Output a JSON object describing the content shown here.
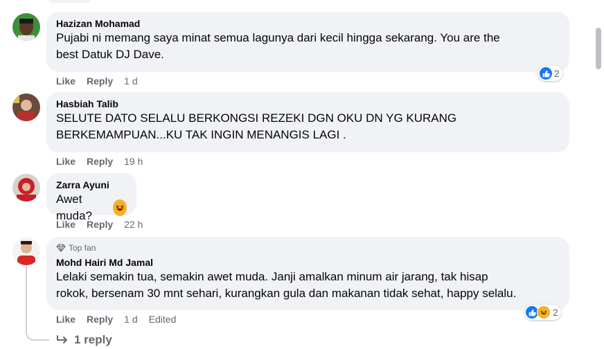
{
  "comments": [
    {
      "author": "Hazizan Mohamad",
      "text_line1": "Pujabi ni memang saya minat semua lagunya dari kecil hingga sekarang. You are the",
      "text_line2": "best Datuk DJ Dave.",
      "like_label": "Like",
      "reply_label": "Reply",
      "time": "1 d",
      "reaction_count": "2",
      "reactions": [
        "like-icon"
      ]
    },
    {
      "author": "Hasbiah Talib",
      "text_line1": "SELUTE DATO SELALU BERKONGSI REZEKI DGN OKU DN YG KURANG",
      "text_line2": "BERKEMAMPUAN...KU TAK INGIN MENANGIS LAGI .",
      "like_label": "Like",
      "reply_label": "Reply",
      "time": "19 h"
    },
    {
      "author": "Zarra Ayuni",
      "text_line1": "Awet muda?",
      "emoji": "haha-emoji",
      "like_label": "Like",
      "reply_label": "Reply",
      "time": "22 h"
    },
    {
      "badge": "Top fan",
      "author": "Mohd Hairi Md Jamal",
      "text_line1": "Lelaki semakin tua, semakin awet muda. Janji amalkan minum air jarang, tak hisap",
      "text_line2": "rokok, bersenam 30 mnt sehari, kurangkan gula dan makanan tidak sehat, happy selalu.",
      "like_label": "Like",
      "reply_label": "Reply",
      "time": "1 d",
      "edited": "Edited",
      "reaction_count": "2",
      "reactions": [
        "like-icon",
        "haha-icon"
      ]
    }
  ],
  "replies_link": "1 reply",
  "colors": {
    "bubble": "#f0f2f5",
    "meta": "#65676b",
    "like_blue": "#1877f2",
    "haha_yellow": "#f7b125"
  }
}
